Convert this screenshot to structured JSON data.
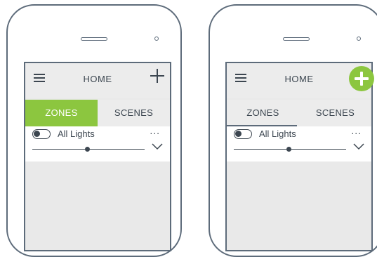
{
  "phones": [
    {
      "header": {
        "title": "HOME",
        "add_style": "plain"
      },
      "tabs": [
        {
          "label": "ZONES",
          "active": true,
          "style": "filled"
        },
        {
          "label": "SCENES",
          "active": false
        }
      ],
      "zone": {
        "label": "All Lights",
        "toggle_on": true,
        "brightness": 0.58,
        "more_label": "..."
      }
    },
    {
      "header": {
        "title": "HOME",
        "add_style": "fab"
      },
      "tabs": [
        {
          "label": "ZONES",
          "active": true,
          "style": "underline"
        },
        {
          "label": "SCENES",
          "active": false
        }
      ],
      "zone": {
        "label": "All Lights",
        "toggle_on": true,
        "brightness": 0.58,
        "more_label": "..."
      }
    }
  ],
  "colors": {
    "accent": "#8cc63f",
    "frame": "#5d6b7a",
    "text": "#3c4650",
    "background": "#e9e9e9"
  }
}
